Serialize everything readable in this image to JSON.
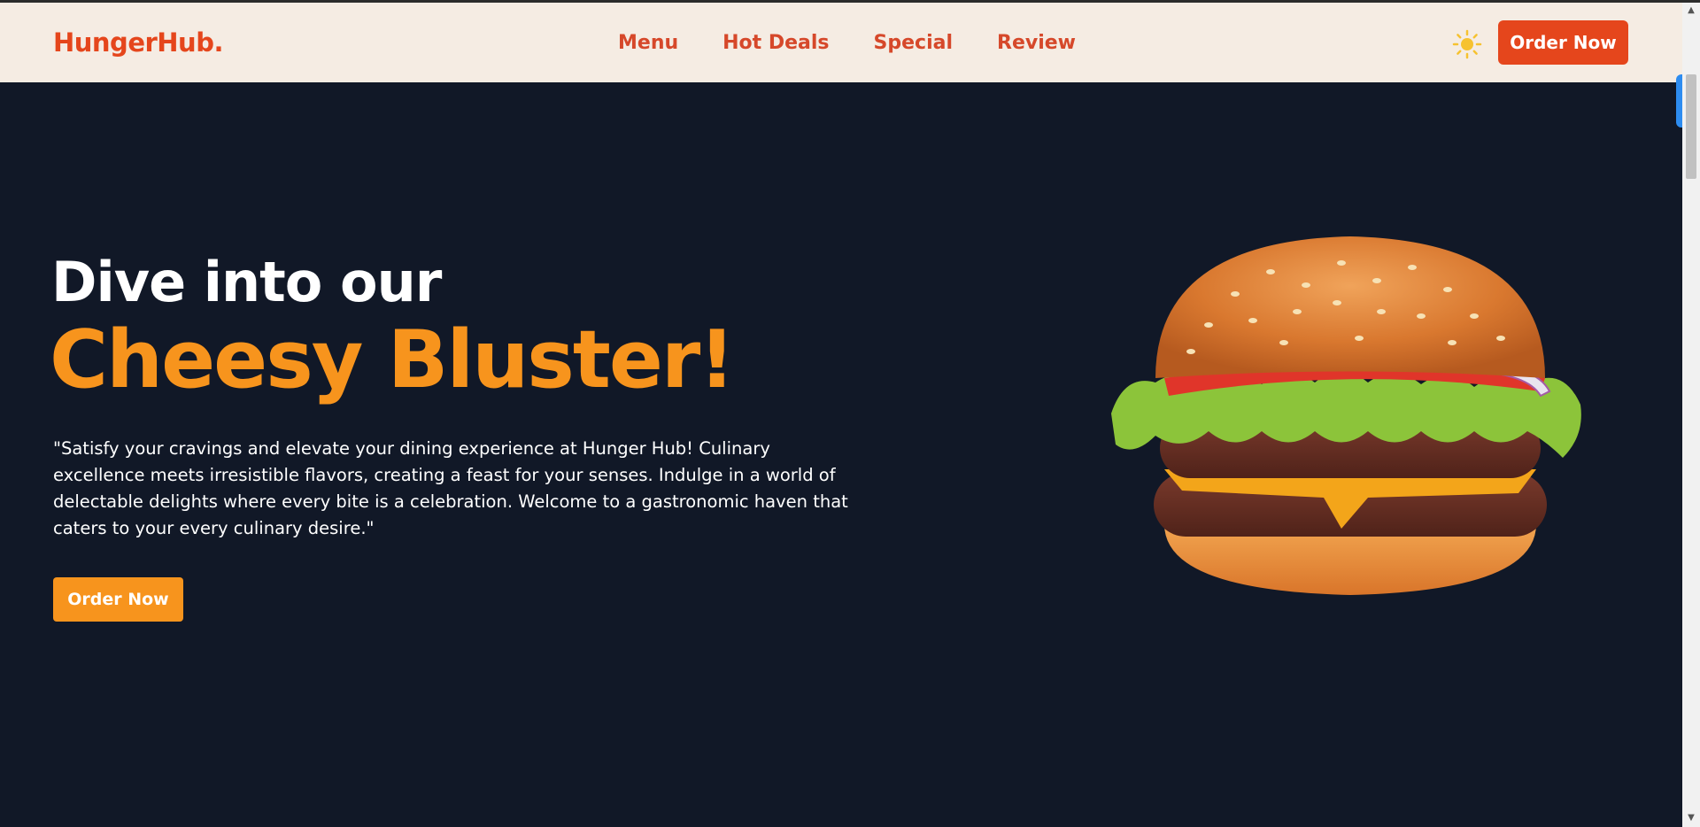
{
  "nav": {
    "brand": "HungerHub.",
    "links": [
      "Menu",
      "Hot Deals",
      "Special",
      "Review"
    ],
    "theme_icon": "sun-icon",
    "order_label": "Order Now"
  },
  "hero": {
    "line1": "Dive into our",
    "line2": "Cheesy Bluster!",
    "description": "\"Satisfy your cravings and elevate your dining experience at Hunger Hub! Culinary excellence meets irresistible flavors, creating a feast for your senses. Indulge in a world of delectable delights where every bite is a celebration. Welcome to a gastronomic haven that caters to your every culinary desire.\"",
    "order_label": "Order Now",
    "image": "burger-image"
  },
  "colors": {
    "background": "#111827",
    "navbar": "#f5ece3",
    "brand_red": "#e5461c",
    "accent_orange": "#f7941d",
    "text": "#ffffff"
  }
}
